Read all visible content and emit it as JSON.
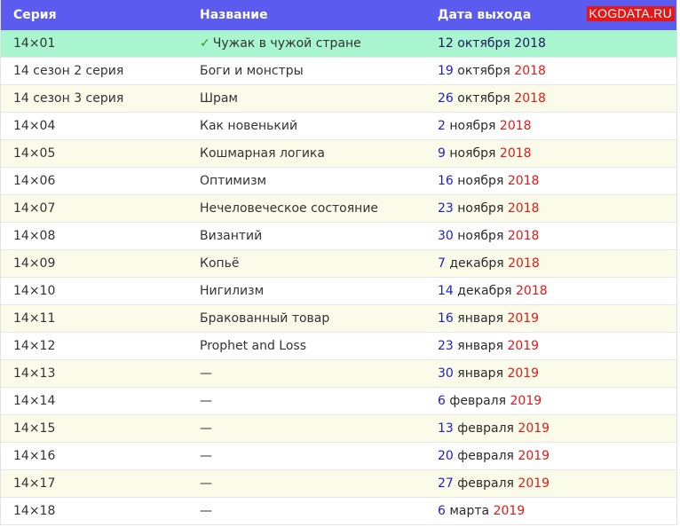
{
  "header": {
    "series": "Серия",
    "title": "Название",
    "date": "Дата выхода",
    "badge": "KOGDATA.RU"
  },
  "colors": {
    "header_bg": "#5b5bf0",
    "current_row": "#a9f5cf",
    "odd_row": "#fafbe8",
    "year": "#e31919",
    "day": "#1e1ec8",
    "badge_bg": "#e31919"
  },
  "rows": [
    {
      "series": "14×01",
      "check": "✓",
      "title": "Чужак в чужой стране",
      "day": "12",
      "month": "октября",
      "year": "2018"
    },
    {
      "series": "14 сезон 2 серия",
      "check": "",
      "title": "Боги и монстры",
      "day": "19",
      "month": "октября",
      "year": "2018"
    },
    {
      "series": "14 сезон 3 серия",
      "check": "",
      "title": "Шрам",
      "day": "26",
      "month": "октября",
      "year": "2018"
    },
    {
      "series": "14×04",
      "check": "",
      "title": "Как новенький",
      "day": "2",
      "month": "ноября",
      "year": "2018"
    },
    {
      "series": "14×05",
      "check": "",
      "title": "Кошмарная логика",
      "day": "9",
      "month": "ноября",
      "year": "2018"
    },
    {
      "series": "14×06",
      "check": "",
      "title": "Оптимизм",
      "day": "16",
      "month": "ноября",
      "year": "2018"
    },
    {
      "series": "14×07",
      "check": "",
      "title": "Нечеловеческое состояние",
      "day": "23",
      "month": "ноября",
      "year": "2018"
    },
    {
      "series": "14×08",
      "check": "",
      "title": "Византий",
      "day": "30",
      "month": "ноября",
      "year": "2018"
    },
    {
      "series": "14×09",
      "check": "",
      "title": "Копьё",
      "day": "7",
      "month": "декабря",
      "year": "2018"
    },
    {
      "series": "14×10",
      "check": "",
      "title": "Нигилизм",
      "day": "14",
      "month": "декабря",
      "year": "2018"
    },
    {
      "series": "14×11",
      "check": "",
      "title": "Бракованный товар",
      "day": "16",
      "month": "января",
      "year": "2019"
    },
    {
      "series": "14×12",
      "check": "",
      "title": "Prophet and Loss",
      "day": "23",
      "month": "января",
      "year": "2019"
    },
    {
      "series": "14×13",
      "check": "",
      "title": "—",
      "day": "30",
      "month": "января",
      "year": "2019"
    },
    {
      "series": "14×14",
      "check": "",
      "title": "—",
      "day": "6",
      "month": "февраля",
      "year": "2019"
    },
    {
      "series": "14×15",
      "check": "",
      "title": "—",
      "day": "13",
      "month": "февраля",
      "year": "2019"
    },
    {
      "series": "14×16",
      "check": "",
      "title": "—",
      "day": "20",
      "month": "февраля",
      "year": "2019"
    },
    {
      "series": "14×17",
      "check": "",
      "title": "—",
      "day": "27",
      "month": "февраля",
      "year": "2019"
    },
    {
      "series": "14×18",
      "check": "",
      "title": "—",
      "day": "6",
      "month": "марта",
      "year": "2019"
    }
  ]
}
